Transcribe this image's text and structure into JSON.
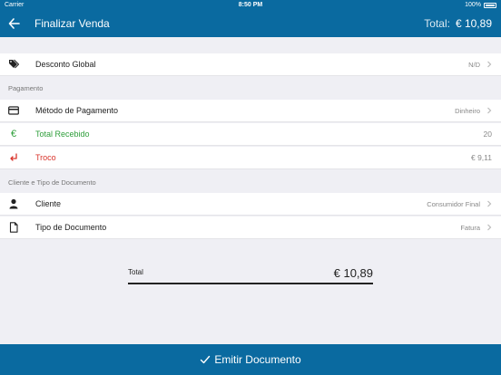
{
  "status_bar": {
    "carrier": "Carrier",
    "time": "8:50 PM",
    "battery": "100%"
  },
  "nav": {
    "title": "Finalizar Venda",
    "total_label": "Total:",
    "total_value": "€ 10,89"
  },
  "discount": {
    "label": "Desconto Global",
    "value": "N/D"
  },
  "payment_section": "Pagamento",
  "payment": {
    "method": {
      "label": "Método de Pagamento",
      "value": "Dinheiro"
    },
    "received": {
      "label": "Total Recebido",
      "value": "20"
    },
    "change": {
      "label": "Troco",
      "value": "€ 9,11"
    }
  },
  "client_section": "Cliente e Tipo de Documento",
  "client": {
    "customer": {
      "label": "Cliente",
      "value": "Consumidor Final"
    },
    "doc_type": {
      "label": "Tipo de Documento",
      "value": "Fatura"
    }
  },
  "summary": {
    "label": "Total",
    "value": "€ 10,89"
  },
  "emit_button": "Emitir Documento",
  "colors": {
    "primary": "#0a6aa0",
    "green": "#2e9e3a",
    "red": "#d9342b",
    "background": "#efeff4"
  }
}
